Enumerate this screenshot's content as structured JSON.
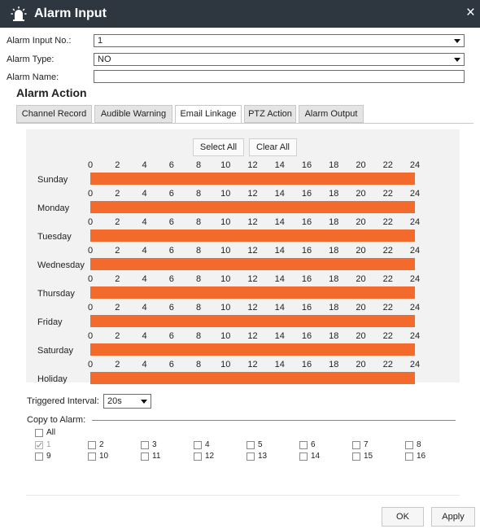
{
  "window": {
    "title": "Alarm Input",
    "close_symbol": "×"
  },
  "form": {
    "input_no_label": "Alarm Input No.:",
    "input_no_value": "1",
    "type_label": "Alarm Type:",
    "type_value": "NO",
    "name_label": "Alarm Name:",
    "name_value": ""
  },
  "section_title": "Alarm Action",
  "tabs": [
    {
      "label": "Channel Record"
    },
    {
      "label": "Audible Warning"
    },
    {
      "label": "Email Linkage",
      "active": true
    },
    {
      "label": "PTZ Action"
    },
    {
      "label": "Alarm Output"
    }
  ],
  "schedule": {
    "select_all": "Select All",
    "clear_all": "Clear All",
    "hour_ticks": [
      "0",
      "2",
      "4",
      "6",
      "8",
      "10",
      "12",
      "14",
      "16",
      "18",
      "20",
      "22",
      "24"
    ],
    "days": [
      "Sunday",
      "Monday",
      "Tuesday",
      "Wednesday",
      "Thursday",
      "Friday",
      "Saturday",
      "Holiday"
    ],
    "active_range_hours": [
      0,
      24
    ],
    "fill_color": "#f36b2c"
  },
  "interval": {
    "label": "Triggered Interval:",
    "value": "20s"
  },
  "copy": {
    "label": "Copy to Alarm:",
    "all_label": "All",
    "channels": [
      "1",
      "2",
      "3",
      "4",
      "5",
      "6",
      "7",
      "8",
      "9",
      "10",
      "11",
      "12",
      "13",
      "14",
      "15",
      "16"
    ],
    "checked": [
      "1"
    ]
  },
  "footer": {
    "ok": "OK",
    "apply": "Apply"
  }
}
